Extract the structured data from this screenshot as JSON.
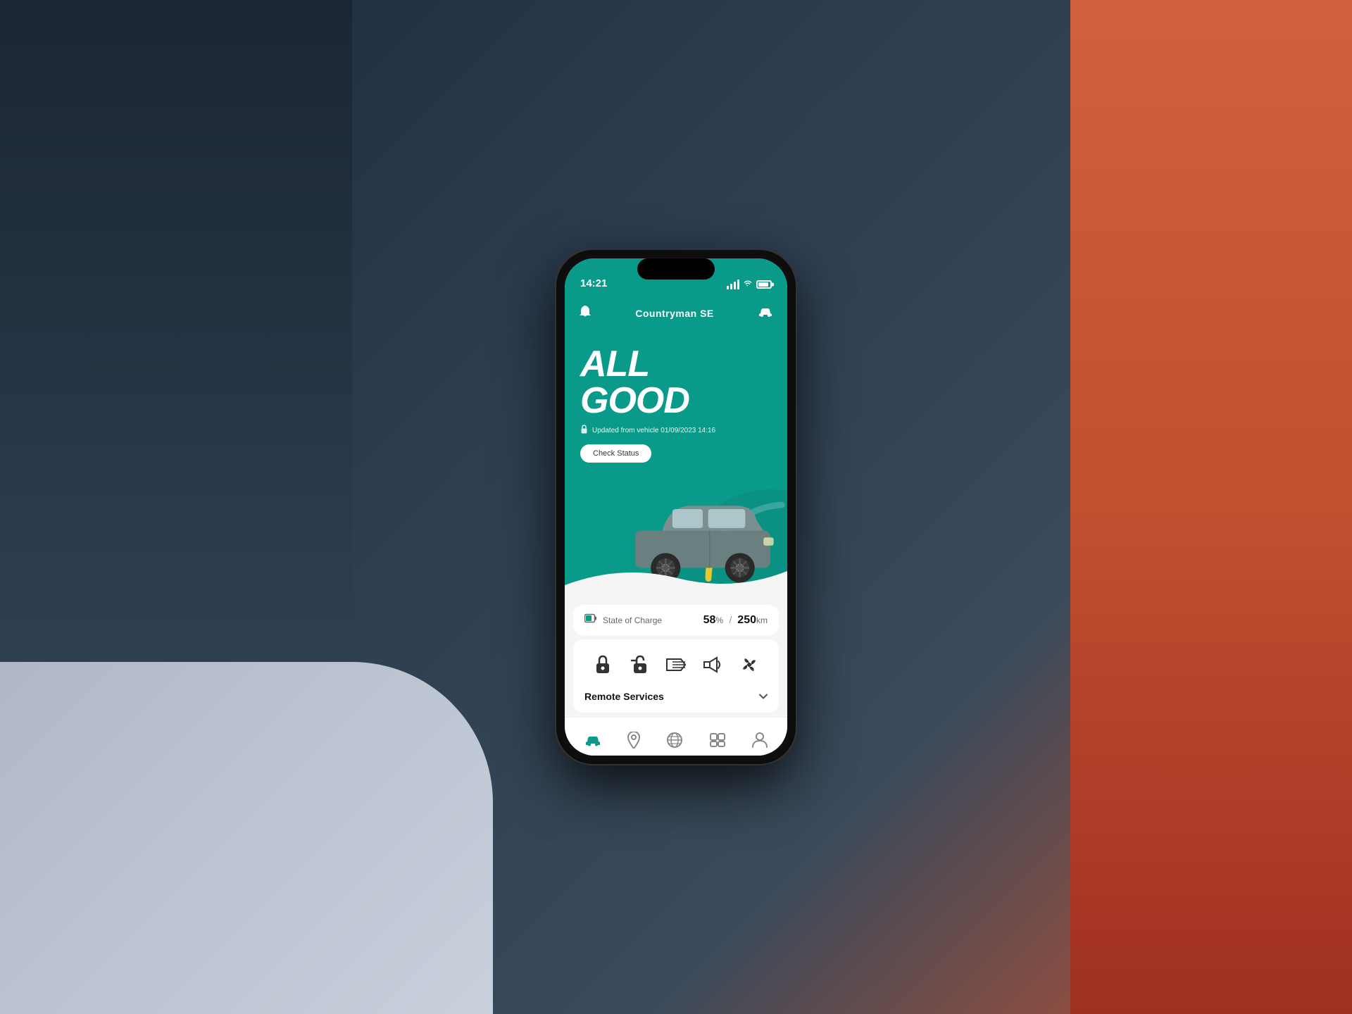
{
  "scene": {
    "bg_color": "#2a3a4a"
  },
  "status_bar": {
    "time": "14:21",
    "signal_label": "signal",
    "wifi_label": "wifi",
    "battery_label": "battery"
  },
  "app_navbar": {
    "title": "Countryman SE",
    "bell_icon": "🔔",
    "car_icon": "🚗"
  },
  "hero": {
    "line1": "ALL",
    "line2": "GOOD",
    "lock_icon": "🔒",
    "subtitle": "Updated from vehicle 01/09/2023 14:16",
    "check_status_btn": "Check Status"
  },
  "soc_card": {
    "label": "State of Charge",
    "percentage": "58",
    "percentage_unit": "%",
    "separator": "/",
    "distance": "250",
    "distance_unit": "km"
  },
  "remote_controls": {
    "icons": [
      {
        "name": "lock-closed-icon",
        "symbol": "🔒"
      },
      {
        "name": "lock-open-icon",
        "symbol": "🔓"
      },
      {
        "name": "lights-icon",
        "symbol": "💡"
      },
      {
        "name": "horn-icon",
        "symbol": "📯"
      },
      {
        "name": "fan-icon",
        "symbol": "❄️"
      }
    ],
    "services_label": "Remote Services",
    "chevron_icon": "›"
  },
  "bottom_nav": {
    "items": [
      {
        "name": "nav-home",
        "icon": "🚗",
        "active": true
      },
      {
        "name": "nav-location",
        "icon": "📍",
        "active": false
      },
      {
        "name": "nav-globe",
        "icon": "🌐",
        "active": false
      },
      {
        "name": "nav-services",
        "icon": "🧰",
        "active": false
      },
      {
        "name": "nav-profile",
        "icon": "👤",
        "active": false
      }
    ]
  },
  "colors": {
    "teal": "#0a9a8a",
    "yellow": "#e8c830",
    "dark": "#111111",
    "white": "#ffffff",
    "light_gray": "#f5f5f5"
  }
}
